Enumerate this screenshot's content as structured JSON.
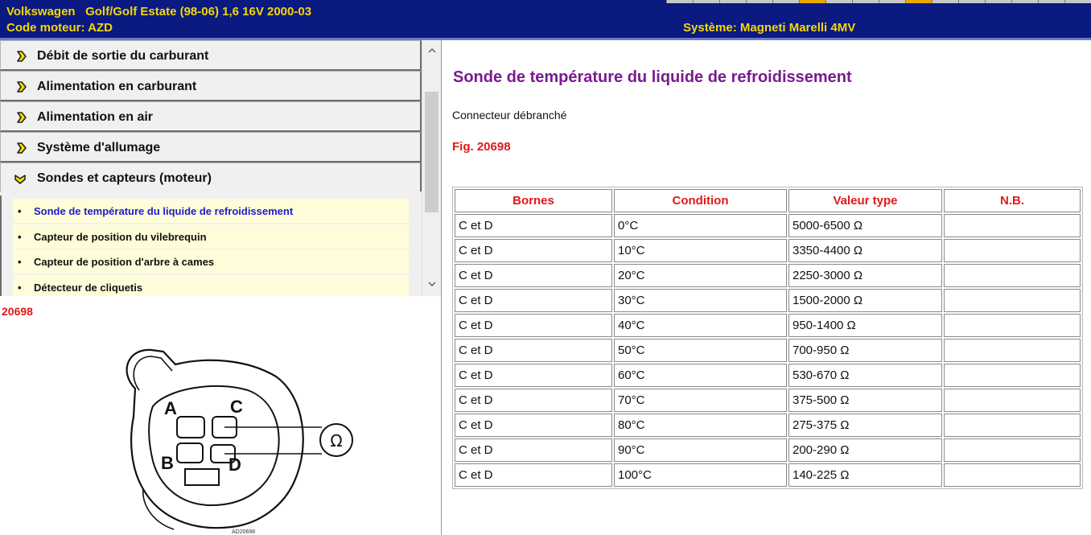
{
  "header": {
    "vehicle": "Volkswagen   Golf/Golf Estate (98-06) 1,6 16V 2000-03",
    "engine_code": "Code moteur: AZD",
    "system": "Système: Magneti Marelli 4MV"
  },
  "nav": {
    "categories": [
      {
        "label": "Débit de sortie du carburant"
      },
      {
        "label": "Alimentation en carburant"
      },
      {
        "label": "Alimentation en air"
      },
      {
        "label": "Système d'allumage"
      },
      {
        "label": "Sondes et capteurs (moteur)"
      }
    ],
    "subitems": [
      {
        "label": "Sonde de température du liquide de refroidissement"
      },
      {
        "label": "Capteur de position du vilebrequin"
      },
      {
        "label": "Capteur de position d'arbre à cames"
      },
      {
        "label": "Détecteur de cliquetis"
      }
    ],
    "icons": {
      "collapsed": "right-arrow-icon",
      "expanded": "down-arrow-icon",
      "scroll_up": "chevron-up-icon",
      "scroll_down": "chevron-down-icon"
    }
  },
  "figure": {
    "number": "20698",
    "pins": {
      "a": "A",
      "b": "B",
      "c": "C",
      "d": "D"
    },
    "ohm_symbol": "Ω",
    "code": "AD20698"
  },
  "content": {
    "title": "Sonde de température du liquide de refroidissement",
    "state": "Connecteur débranché",
    "fig_ref": "Fig. 20698",
    "table": {
      "headers": [
        "Bornes",
        "Condition",
        "Valeur type",
        "N.B."
      ],
      "rows": [
        [
          "C et D",
          "0°C",
          "5000-6500 Ω",
          ""
        ],
        [
          "C et D",
          "10°C",
          "3350-4400 Ω",
          ""
        ],
        [
          "C et D",
          "20°C",
          "2250-3000 Ω",
          ""
        ],
        [
          "C et D",
          "30°C",
          "1500-2000 Ω",
          ""
        ],
        [
          "C et D",
          "40°C",
          "950-1400 Ω",
          ""
        ],
        [
          "C et D",
          "50°C",
          "700-950 Ω",
          ""
        ],
        [
          "C et D",
          "60°C",
          "530-670 Ω",
          ""
        ],
        [
          "C et D",
          "70°C",
          "375-500 Ω",
          ""
        ],
        [
          "C et D",
          "80°C",
          "275-375 Ω",
          ""
        ],
        [
          "C et D",
          "90°C",
          "200-290 Ω",
          ""
        ],
        [
          "C et D",
          "100°C",
          "140-225 Ω",
          ""
        ]
      ]
    }
  },
  "colors": {
    "header_bg": "#0a1a80",
    "header_text": "#f4d60a",
    "title": "#7a1a90",
    "accent_red": "#e21818",
    "active_link": "#1c1ccc",
    "subitem_bg": "#fffdd9"
  }
}
